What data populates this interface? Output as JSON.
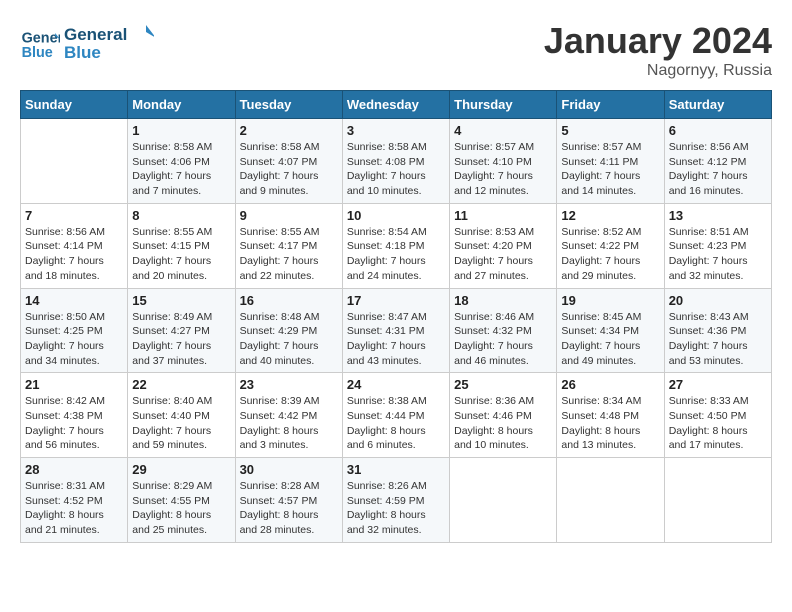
{
  "header": {
    "logo_line1": "General",
    "logo_line2": "Blue",
    "month": "January 2024",
    "location": "Nagornyy, Russia"
  },
  "days_of_week": [
    "Sunday",
    "Monday",
    "Tuesday",
    "Wednesday",
    "Thursday",
    "Friday",
    "Saturday"
  ],
  "weeks": [
    [
      {
        "day": "",
        "sunrise": "",
        "sunset": "",
        "daylight": ""
      },
      {
        "day": "1",
        "sunrise": "8:58 AM",
        "sunset": "4:06 PM",
        "daylight": "7 hours and 7 minutes."
      },
      {
        "day": "2",
        "sunrise": "8:58 AM",
        "sunset": "4:07 PM",
        "daylight": "7 hours and 9 minutes."
      },
      {
        "day": "3",
        "sunrise": "8:58 AM",
        "sunset": "4:08 PM",
        "daylight": "7 hours and 10 minutes."
      },
      {
        "day": "4",
        "sunrise": "8:57 AM",
        "sunset": "4:10 PM",
        "daylight": "7 hours and 12 minutes."
      },
      {
        "day": "5",
        "sunrise": "8:57 AM",
        "sunset": "4:11 PM",
        "daylight": "7 hours and 14 minutes."
      },
      {
        "day": "6",
        "sunrise": "8:56 AM",
        "sunset": "4:12 PM",
        "daylight": "7 hours and 16 minutes."
      }
    ],
    [
      {
        "day": "7",
        "sunrise": "8:56 AM",
        "sunset": "4:14 PM",
        "daylight": "7 hours and 18 minutes."
      },
      {
        "day": "8",
        "sunrise": "8:55 AM",
        "sunset": "4:15 PM",
        "daylight": "7 hours and 20 minutes."
      },
      {
        "day": "9",
        "sunrise": "8:55 AM",
        "sunset": "4:17 PM",
        "daylight": "7 hours and 22 minutes."
      },
      {
        "day": "10",
        "sunrise": "8:54 AM",
        "sunset": "4:18 PM",
        "daylight": "7 hours and 24 minutes."
      },
      {
        "day": "11",
        "sunrise": "8:53 AM",
        "sunset": "4:20 PM",
        "daylight": "7 hours and 27 minutes."
      },
      {
        "day": "12",
        "sunrise": "8:52 AM",
        "sunset": "4:22 PM",
        "daylight": "7 hours and 29 minutes."
      },
      {
        "day": "13",
        "sunrise": "8:51 AM",
        "sunset": "4:23 PM",
        "daylight": "7 hours and 32 minutes."
      }
    ],
    [
      {
        "day": "14",
        "sunrise": "8:50 AM",
        "sunset": "4:25 PM",
        "daylight": "7 hours and 34 minutes."
      },
      {
        "day": "15",
        "sunrise": "8:49 AM",
        "sunset": "4:27 PM",
        "daylight": "7 hours and 37 minutes."
      },
      {
        "day": "16",
        "sunrise": "8:48 AM",
        "sunset": "4:29 PM",
        "daylight": "7 hours and 40 minutes."
      },
      {
        "day": "17",
        "sunrise": "8:47 AM",
        "sunset": "4:31 PM",
        "daylight": "7 hours and 43 minutes."
      },
      {
        "day": "18",
        "sunrise": "8:46 AM",
        "sunset": "4:32 PM",
        "daylight": "7 hours and 46 minutes."
      },
      {
        "day": "19",
        "sunrise": "8:45 AM",
        "sunset": "4:34 PM",
        "daylight": "7 hours and 49 minutes."
      },
      {
        "day": "20",
        "sunrise": "8:43 AM",
        "sunset": "4:36 PM",
        "daylight": "7 hours and 53 minutes."
      }
    ],
    [
      {
        "day": "21",
        "sunrise": "8:42 AM",
        "sunset": "4:38 PM",
        "daylight": "7 hours and 56 minutes."
      },
      {
        "day": "22",
        "sunrise": "8:40 AM",
        "sunset": "4:40 PM",
        "daylight": "7 hours and 59 minutes."
      },
      {
        "day": "23",
        "sunrise": "8:39 AM",
        "sunset": "4:42 PM",
        "daylight": "8 hours and 3 minutes."
      },
      {
        "day": "24",
        "sunrise": "8:38 AM",
        "sunset": "4:44 PM",
        "daylight": "8 hours and 6 minutes."
      },
      {
        "day": "25",
        "sunrise": "8:36 AM",
        "sunset": "4:46 PM",
        "daylight": "8 hours and 10 minutes."
      },
      {
        "day": "26",
        "sunrise": "8:34 AM",
        "sunset": "4:48 PM",
        "daylight": "8 hours and 13 minutes."
      },
      {
        "day": "27",
        "sunrise": "8:33 AM",
        "sunset": "4:50 PM",
        "daylight": "8 hours and 17 minutes."
      }
    ],
    [
      {
        "day": "28",
        "sunrise": "8:31 AM",
        "sunset": "4:52 PM",
        "daylight": "8 hours and 21 minutes."
      },
      {
        "day": "29",
        "sunrise": "8:29 AM",
        "sunset": "4:55 PM",
        "daylight": "8 hours and 25 minutes."
      },
      {
        "day": "30",
        "sunrise": "8:28 AM",
        "sunset": "4:57 PM",
        "daylight": "8 hours and 28 minutes."
      },
      {
        "day": "31",
        "sunrise": "8:26 AM",
        "sunset": "4:59 PM",
        "daylight": "8 hours and 32 minutes."
      },
      {
        "day": "",
        "sunrise": "",
        "sunset": "",
        "daylight": ""
      },
      {
        "day": "",
        "sunrise": "",
        "sunset": "",
        "daylight": ""
      },
      {
        "day": "",
        "sunrise": "",
        "sunset": "",
        "daylight": ""
      }
    ]
  ],
  "labels": {
    "sunrise": "Sunrise:",
    "sunset": "Sunset:",
    "daylight": "Daylight:"
  }
}
